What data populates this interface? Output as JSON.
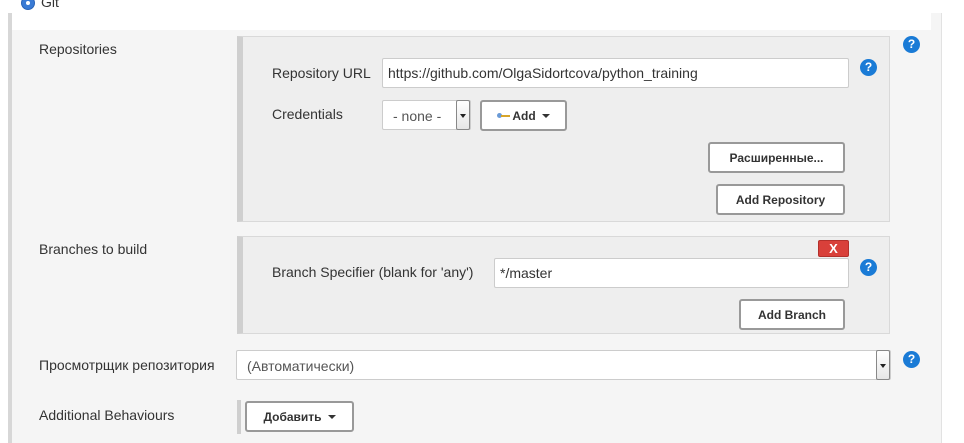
{
  "scm": {
    "option_label": "Git"
  },
  "repositories": {
    "label": "Repositories",
    "url_label": "Repository URL",
    "url_value": "https://github.com/OlgaSidortcova/python_training",
    "credentials_label": "Credentials",
    "credentials_selected": "- none -",
    "add_credentials_label": "Add",
    "advanced_label": "Расширенные...",
    "add_repository_label": "Add Repository"
  },
  "branches": {
    "label": "Branches to build",
    "delete_label": "X",
    "specifier_label": "Branch Specifier (blank for 'any')",
    "specifier_value": "*/master",
    "add_branch_label": "Add Branch"
  },
  "browser": {
    "label": "Просмотрщик репозитория",
    "selected": "(Автоматически)"
  },
  "behaviours": {
    "label": "Additional Behaviours",
    "add_label": "Добавить"
  },
  "help_glyph": "?",
  "colors": {
    "help": "#1a7bd6",
    "delete": "#d9403a",
    "radio": "#3a7bd5"
  }
}
